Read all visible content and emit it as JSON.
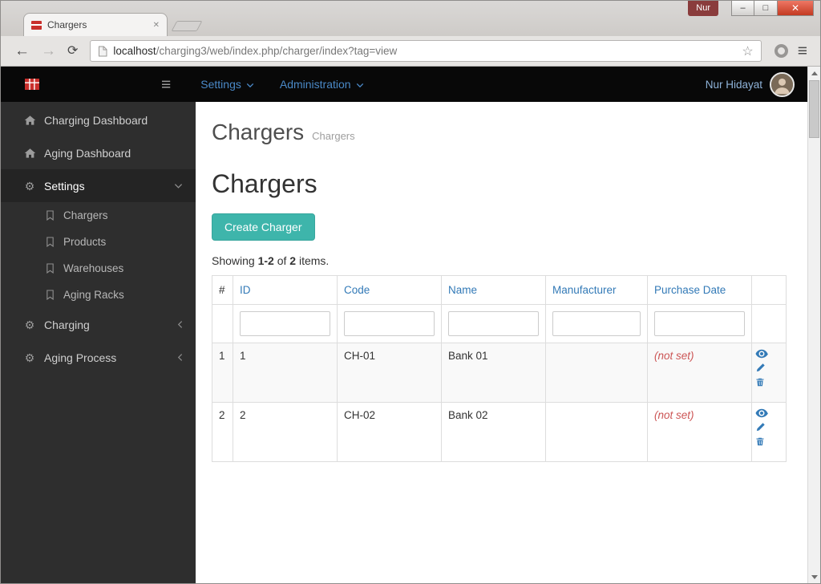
{
  "colors": {
    "accent_teal": "#3eb5ab",
    "navbar_link_blue": "#4a89c7",
    "table_link_blue": "#337ab7",
    "not_set_red": "#cc5555",
    "sidebar_bg": "#2e2e2e",
    "navbar_bg": "#080808"
  },
  "icons": {
    "back": "←",
    "forward": "→",
    "reload": "⟳",
    "star": "☆",
    "menu": "≡",
    "hamburger": "≡",
    "minimize": "–",
    "maximize": "□",
    "close": "✕",
    "tab_close": "✕",
    "gear": "⚙"
  },
  "browser": {
    "tab_title": "Chargers",
    "profile_name": "Nur",
    "url_host": "localhost",
    "url_path": "/charging3/web/index.php/charger/index?tag=view"
  },
  "navbar": {
    "menus": [
      {
        "label": "Settings"
      },
      {
        "label": "Administration"
      }
    ],
    "user_name": "Nur Hidayat"
  },
  "sidebar": {
    "items": [
      {
        "label": "Charging Dashboard"
      },
      {
        "label": "Aging Dashboard"
      },
      {
        "label": "Settings"
      },
      {
        "label": "Chargers"
      },
      {
        "label": "Products"
      },
      {
        "label": "Warehouses"
      },
      {
        "label": "Aging Racks"
      },
      {
        "label": "Charging"
      },
      {
        "label": "Aging Process"
      }
    ]
  },
  "main": {
    "header_title": "Chargers",
    "header_subtitle": "Chargers",
    "heading": "Chargers",
    "create_button": "Create Charger",
    "summary": {
      "prefix": "Showing ",
      "range": "1-2",
      "mid": " of ",
      "total": "2",
      "suffix": " items."
    },
    "table": {
      "headers": [
        "#",
        "ID",
        "Code",
        "Name",
        "Manufacturer",
        "Purchase Date"
      ],
      "rows": [
        {
          "num": "1",
          "id": "1",
          "code": "CH-01",
          "name": "Bank 01",
          "manufacturer": "",
          "purchase_date": "(not set)"
        },
        {
          "num": "2",
          "id": "2",
          "code": "CH-02",
          "name": "Bank 02",
          "manufacturer": "",
          "purchase_date": "(not set)"
        }
      ]
    }
  }
}
